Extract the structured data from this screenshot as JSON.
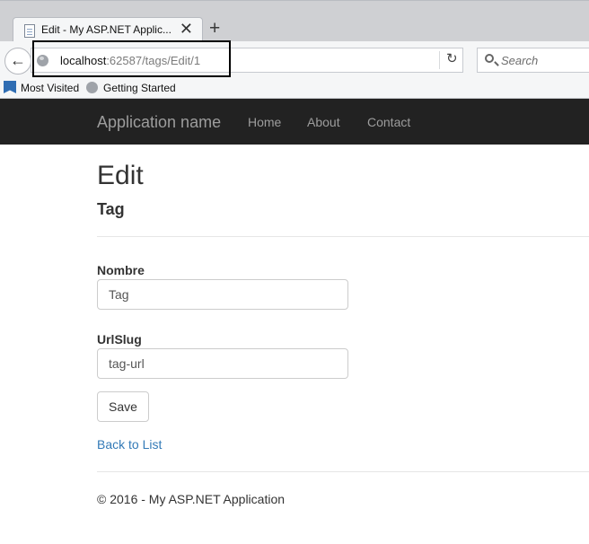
{
  "browser": {
    "tab_title": "Edit - My ASP.NET Applic...",
    "tab_close": "✕",
    "new_tab": "+",
    "url_host": "localhost",
    "url_path": ":62587/tags/Edit/1",
    "search_placeholder": "Search",
    "bookmarks": [
      "Most Visited",
      "Getting Started"
    ]
  },
  "site": {
    "brand": "Application name",
    "nav": [
      "Home",
      "About",
      "Contact"
    ]
  },
  "page": {
    "title": "Edit",
    "subtitle": "Tag",
    "fields": [
      {
        "label": "Nombre",
        "value": "Tag"
      },
      {
        "label": "UrlSlug",
        "value": "tag-url"
      }
    ],
    "save_label": "Save",
    "back_link": "Back to List",
    "footer": "© 2016 - My ASP.NET Application"
  },
  "colors": {
    "navbar_bg": "#222222",
    "nav_text": "#9d9d9d",
    "link": "#337ab7",
    "highlight_border": "#000000"
  },
  "icons": [
    "page-icon",
    "close-icon",
    "plus-icon",
    "back-arrow-icon",
    "globe-icon",
    "reload-icon",
    "search-icon",
    "bookmarks-icon"
  ]
}
